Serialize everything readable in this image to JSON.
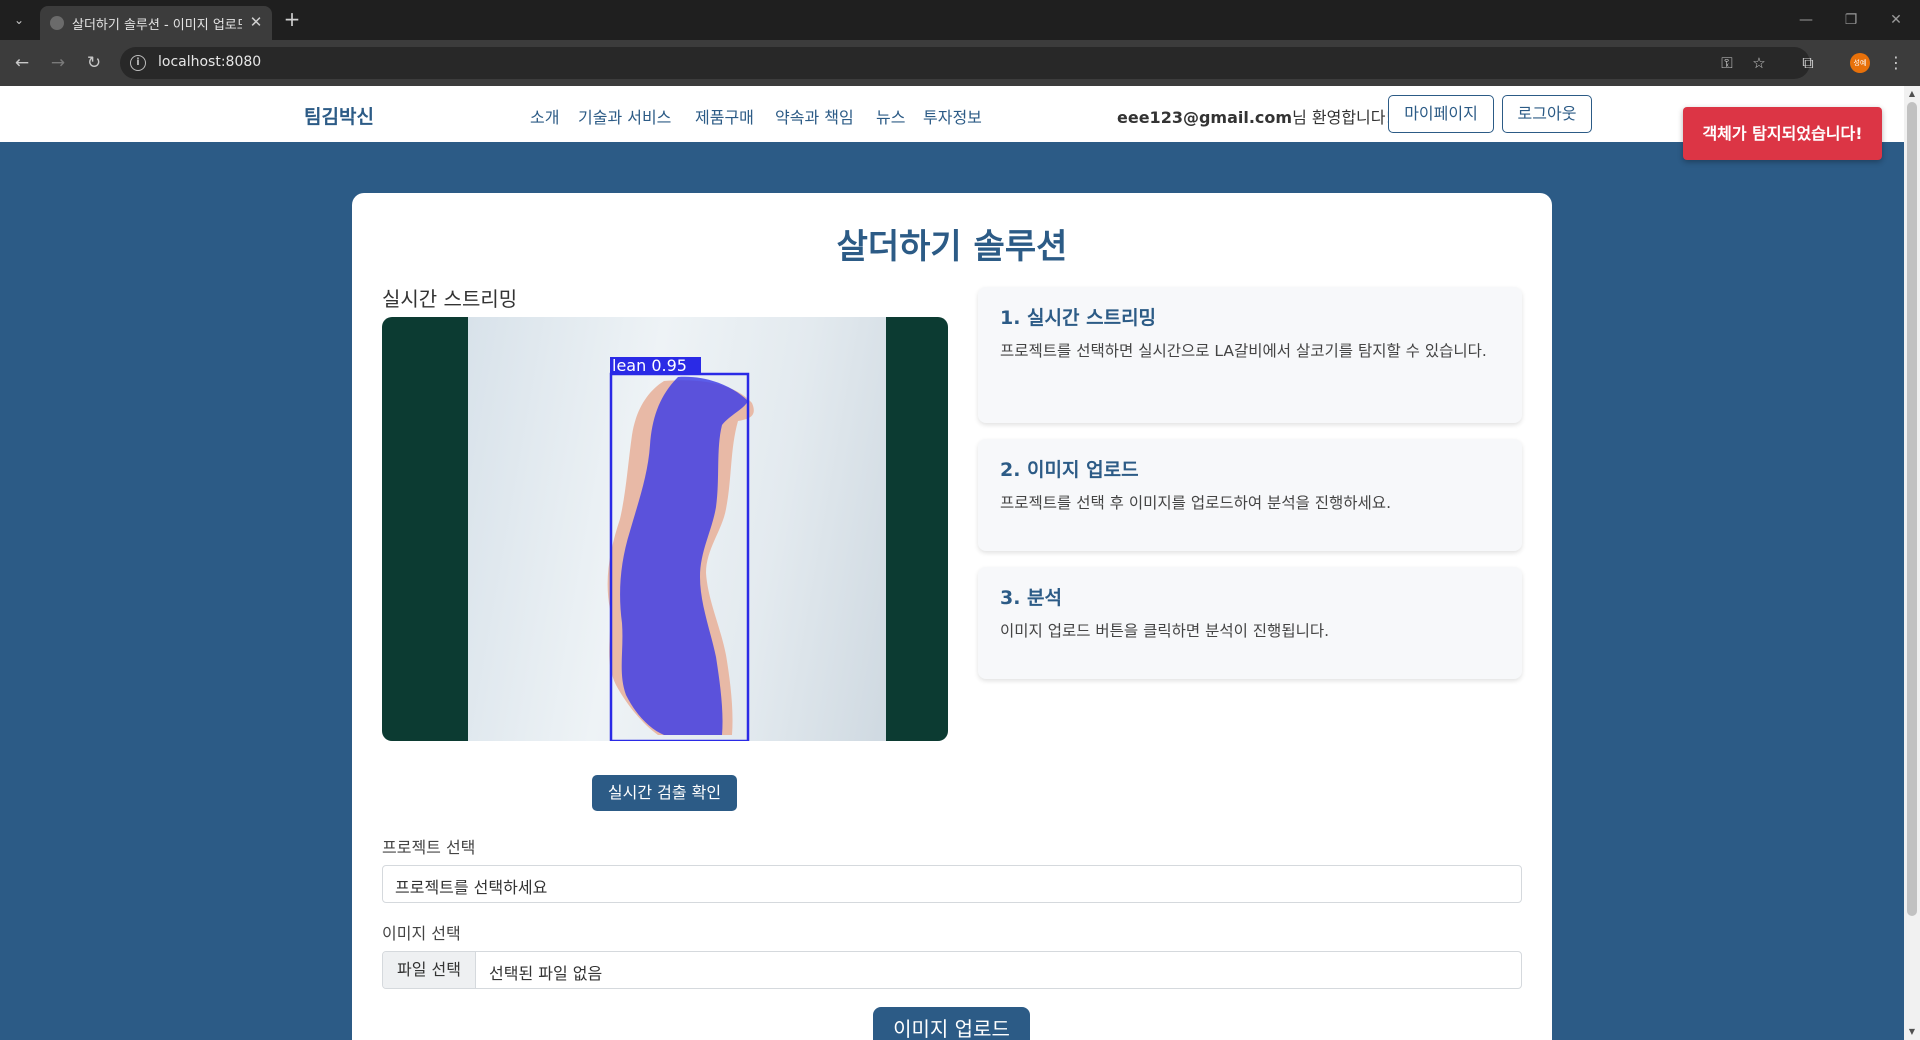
{
  "browser": {
    "tab_title": "살더하기 솔루션 - 이미지 업로드",
    "url": "localhost:8080",
    "profile_initials": "성예"
  },
  "header": {
    "brand": "팀김박신",
    "nav": [
      "소개",
      "기술과 서비스",
      "제품구매",
      "약속과 책임",
      "뉴스",
      "투자정보"
    ],
    "user_email": "eee123@gmail.com",
    "welcome_suffix": "님 환영합니다!",
    "mypage_label": "마이페이지",
    "logout_label": "로그아웃"
  },
  "toast": {
    "message": "객체가 탐지되었습니다!"
  },
  "main": {
    "title": "살더하기 솔루션",
    "stream_label": "실시간 스트리밍",
    "detection": {
      "label": "lean",
      "confidence": "0.95"
    },
    "detect_button": "실시간 검출 확인",
    "steps": [
      {
        "title": "1. 실시간 스트리밍",
        "text": "프로젝트를 선택하면 실시간으로 LA갈비에서 살코기를 탐지할 수 있습니다."
      },
      {
        "title": "2. 이미지 업로드",
        "text": "프로젝트를 선택 후 이미지를 업로드하여 분석을 진행하세요."
      },
      {
        "title": "3. 분석",
        "text": "이미지 업로드 버튼을 클릭하면 분석이 진행됩니다."
      }
    ],
    "project_label": "프로젝트 선택",
    "project_placeholder": "프로젝트를 선택하세요",
    "image_label": "이미지 선택",
    "file_button": "파일 선택",
    "file_status": "선택된 파일 없음",
    "upload_button": "이미지 업로드"
  },
  "colors": {
    "primary": "#2c5b86",
    "toast": "#dc3545",
    "mask": "#3c3ce6"
  }
}
